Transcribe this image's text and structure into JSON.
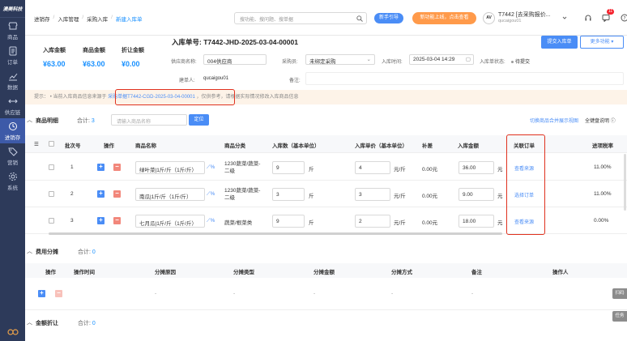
{
  "app": {
    "logo": "澳美科技"
  },
  "sidebar": {
    "items": [
      {
        "label": "商品",
        "icon": "goods-icon"
      },
      {
        "label": "订单",
        "icon": "order-icon"
      },
      {
        "label": "数据",
        "icon": "chart-icon"
      },
      {
        "label": "供应链",
        "icon": "supply-chain-icon"
      },
      {
        "label": "进销存",
        "icon": "inventory-icon",
        "active": true
      },
      {
        "label": "营销",
        "icon": "marketing-icon"
      },
      {
        "label": "系统",
        "icon": "settings-icon"
      }
    ]
  },
  "topbar": {
    "breadcrumbs": [
      "进销存",
      "入库管理",
      "采购入库",
      "新建入库单"
    ],
    "search_placeholder": "搜功能、搜问题、搜单据",
    "guide_button": "新手引导",
    "promo_button": "新功能上线，点击查看",
    "avatar_text": "AV",
    "company_name": "T7442 [去采购报价...",
    "company_user": "qucaigou01",
    "notification_count": "11"
  },
  "summary": {
    "inbound_amount_label": "入库金额",
    "inbound_amount": "¥63.00",
    "product_amount_label": "商品金额",
    "product_amount": "¥63.00",
    "discount_amount_label": "折让金额",
    "discount_amount": "¥0.00"
  },
  "order": {
    "number_label": "入库单号:",
    "number": "T7442-JHD-2025-03-04-00001",
    "submit_button": "提交入库单",
    "more_button": "更多功能",
    "supplier_label": "供应商名称:",
    "supplier": "004供应商",
    "buyer_label": "采购员:",
    "buyer": "未绑定采购",
    "time_label": "入库时间:",
    "time": "2025-03-04 14:29",
    "status_label": "入库单状态:",
    "status": "待提交",
    "creator_label": "建单人:",
    "creator": "qucaigou01",
    "remark_label": "备注:"
  },
  "tip": {
    "prefix": "提示：",
    "text_before": "• 当前入库商品信息来源于",
    "purchase_order": "采购单据T7442-CGD-2025-03-04-00001",
    "text_after": "，仅供参考，请根据实际情况修改入库商品信息"
  },
  "products": {
    "section_title": "商品明细",
    "total_label": "合计:",
    "total": "3",
    "search_placeholder": "请输入商品名称",
    "locate_button": "定位",
    "switch_link": "切换商品合并展示视图",
    "shortcut_label": "全键盘说明",
    "columns": [
      "批次号",
      "操作",
      "商品名称",
      "商品分类",
      "入库数（基本单位）",
      "入库单价（基本单位）",
      "补差",
      "入库金额",
      "关联订单",
      "进项税率"
    ],
    "rows": [
      {
        "batch": "1",
        "name": "绿叶菜|1斤/斤（1斤/斤）",
        "category": "1230蔬菜/蔬菜-二级",
        "qty": "9",
        "qty_unit": "斤",
        "price": "4",
        "price_unit": "元/斤",
        "diff": "0.00元",
        "amount": "36.00",
        "amount_unit": "元",
        "link": "查看来源",
        "tax": "11.00%"
      },
      {
        "batch": "2",
        "name": "南瓜|1斤/斤（1斤/斤）",
        "category": "1230蔬菜/蔬菜-二级",
        "qty": "3",
        "qty_unit": "斤",
        "price": "3",
        "price_unit": "元/斤",
        "diff": "0.00元",
        "amount": "9.00",
        "amount_unit": "元",
        "link": "选择订单",
        "tax": "11.00%"
      },
      {
        "batch": "3",
        "name": "七月瓜|1斤/斤（1斤/斤）",
        "category": "蔬菜/根菜类",
        "qty": "9",
        "qty_unit": "斤",
        "price": "2",
        "price_unit": "元/斤",
        "diff": "0.00元",
        "amount": "18.00",
        "amount_unit": "元",
        "link": "查看来源",
        "tax": "0.00%"
      }
    ]
  },
  "costs": {
    "section_title": "费用分摊",
    "total_label": "合计:",
    "total": "0",
    "columns": [
      "操作",
      "操作时间",
      "分摊原因",
      "分摊类型",
      "分摊金额",
      "分摊方式",
      "备注",
      "操作人"
    ],
    "placeholder": "-"
  },
  "discount": {
    "section_title": "金额折让",
    "total_label": "合计:",
    "total": "0"
  },
  "side_tags": {
    "top": "扫码",
    "bottom": "任务"
  }
}
